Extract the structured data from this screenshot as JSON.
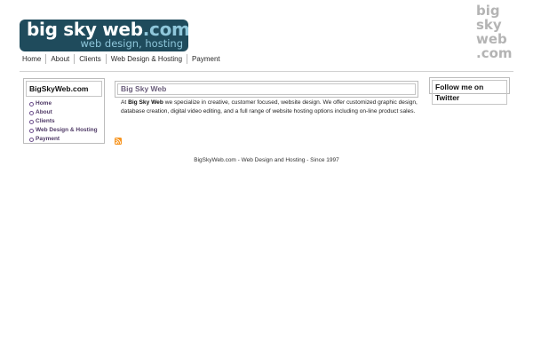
{
  "logo": {
    "name": "big sky web",
    "ext": ".com",
    "tagline": "web design, hosting"
  },
  "side_logo": {
    "line1": "big",
    "line2": "sky",
    "line3": "web",
    "line4": ".com"
  },
  "nav": [
    "Home",
    "About",
    "Clients",
    "Web Design & Hosting",
    "Payment"
  ],
  "sidebar": {
    "title": "BigSkyWeb.com",
    "items": [
      "Home",
      "About",
      "Clients",
      "Web Design & Hosting",
      "Payment"
    ]
  },
  "main": {
    "title": "Big Sky Web",
    "text_pre": "At ",
    "text_strong": "Big Sky Web",
    "text_post": " we specialize in creative, customer focused, website design. We offer customized graphic design, database creation, digital video editing, and a full range of website hosting options including on-line product sales."
  },
  "twitter": {
    "title": "Follow me on Twitter"
  },
  "footer": "BigSkyWeb.com - Web Design and Hosting - Since 1997",
  "colors": {
    "logo_bg": "#1f4b5c",
    "logo_accent": "#8fc7db",
    "link": "#4f3a66",
    "rss": "#f7941e"
  },
  "icons": {
    "feed": "rss-feed-icon"
  }
}
